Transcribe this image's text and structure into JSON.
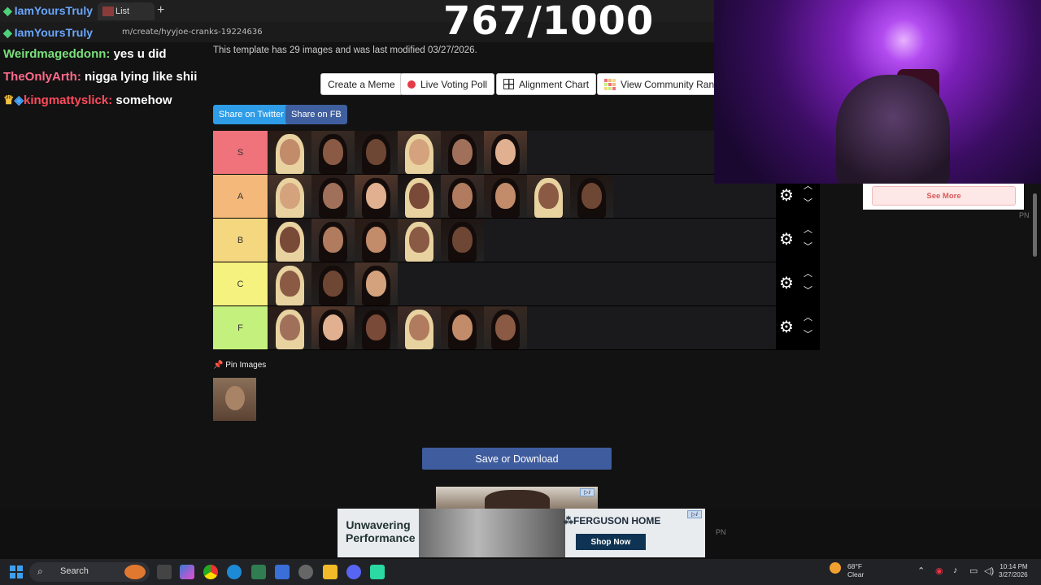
{
  "browser": {
    "tab_title": "List",
    "url": "m/create/hyyjoe-cranks-19224636",
    "streamer_overlay": "IamYoursTruly"
  },
  "counter": "767/1000",
  "chat": [
    {
      "name": "Weirdmageddonn:",
      "message": "yes u did",
      "color": "green"
    },
    {
      "name": "TheOnlyArth:",
      "message": "nigga lying like shii",
      "color": "pink"
    },
    {
      "name": "kingmattyslick:",
      "message": "somehow",
      "color": "red"
    }
  ],
  "page": {
    "meta_text": "This template has 29 images and was last modified 03/27/2026.",
    "buttons": {
      "create_meme": "Create a Meme",
      "live_voting": "Live Voting Poll",
      "alignment_chart": "Alignment Chart",
      "community_rank": "View Community Rank"
    },
    "share": {
      "twitter": "Share on Twitter",
      "fb": "Share on FB"
    },
    "pin_images": "Pin Images",
    "save": "Save or Download"
  },
  "tiers": [
    {
      "label": "S",
      "color": "#f0727a",
      "count": 6
    },
    {
      "label": "A",
      "color": "#f4b97a",
      "count": 8
    },
    {
      "label": "B",
      "color": "#f5d77f",
      "count": 5
    },
    {
      "label": "C",
      "color": "#f6f27f",
      "count": 3
    },
    {
      "label": "F",
      "color": "#c4f07e",
      "count": 6
    }
  ],
  "ads": {
    "bottom_headline": "Unwavering Performance",
    "bottom_brand": "FERGUSON HOME",
    "bottom_cta": "Shop Now",
    "side_cta": "See More",
    "pn": "PN"
  },
  "taskbar": {
    "search": "Search",
    "temp": "68°F",
    "weather": "Clear",
    "time": "10:14 PM",
    "date": "3/27/2026"
  }
}
